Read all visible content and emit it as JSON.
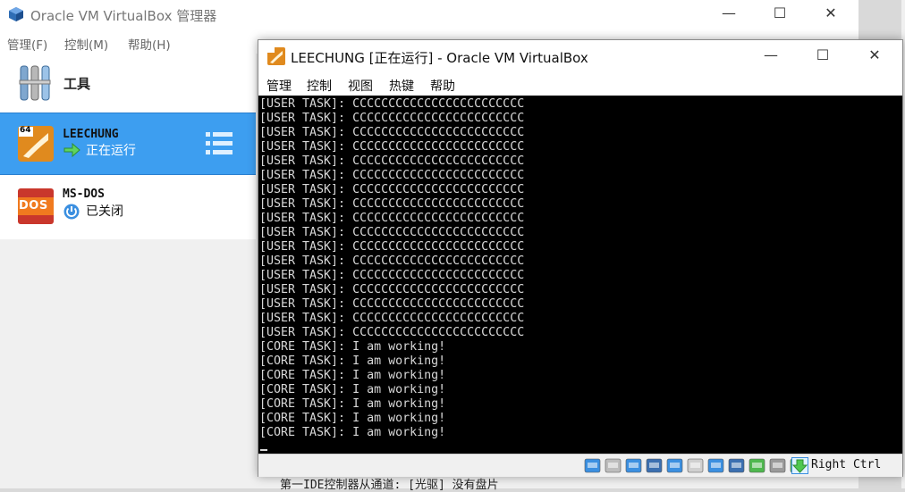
{
  "manager": {
    "title": "Oracle VM VirtualBox 管理器",
    "menu": [
      "管理(F)",
      "控制(M)",
      "帮助(H)"
    ],
    "tools_label": "工具",
    "vms": [
      {
        "name": "LEECHUNG",
        "state": "正在运行",
        "selected": true,
        "badge": "64"
      },
      {
        "name": "MS-DOS",
        "state": "已关闭",
        "selected": false,
        "badge": "DOS"
      }
    ],
    "bottom_text": "第一IDE控制器从通道: [光驱] 没有盘片"
  },
  "vm_window": {
    "title": "LEECHUNG [正在运行] - Oracle VM VirtualBox",
    "menu": [
      "管理",
      "控制",
      "视图",
      "热键",
      "帮助"
    ],
    "screen_lines": [
      "[USER TASK]: CCCCCCCCCCCCCCCCCCCCCCCC",
      "[USER TASK]: CCCCCCCCCCCCCCCCCCCCCCCC",
      "[USER TASK]: CCCCCCCCCCCCCCCCCCCCCCCC",
      "[USER TASK]: CCCCCCCCCCCCCCCCCCCCCCCC",
      "[USER TASK]: CCCCCCCCCCCCCCCCCCCCCCCC",
      "[USER TASK]: CCCCCCCCCCCCCCCCCCCCCCCC",
      "[USER TASK]: CCCCCCCCCCCCCCCCCCCCCCCC",
      "[USER TASK]: CCCCCCCCCCCCCCCCCCCCCCCC",
      "[USER TASK]: CCCCCCCCCCCCCCCCCCCCCCCC",
      "[USER TASK]: CCCCCCCCCCCCCCCCCCCCCCCC",
      "[USER TASK]: CCCCCCCCCCCCCCCCCCCCCCCC",
      "[USER TASK]: CCCCCCCCCCCCCCCCCCCCCCCC",
      "[USER TASK]: CCCCCCCCCCCCCCCCCCCCCCCC",
      "[USER TASK]: CCCCCCCCCCCCCCCCCCCCCCCC",
      "[USER TASK]: CCCCCCCCCCCCCCCCCCCCCCCC",
      "[USER TASK]: CCCCCCCCCCCCCCCCCCCCCCCC",
      "[USER TASK]: CCCCCCCCCCCCCCCCCCCCCCCC",
      "[CORE TASK]: I am working!",
      "[CORE TASK]: I am working!",
      "[CORE TASK]: I am working!",
      "[CORE TASK]: I am working!",
      "[CORE TASK]: I am working!",
      "[CORE TASK]: I am working!",
      "[CORE TASK]: I am working!"
    ],
    "host_key": "Right Ctrl",
    "status_icons": [
      "hard-disk-icon",
      "optical-disk-icon",
      "audio-icon",
      "network-icon",
      "usb-icon",
      "shared-folders-icon",
      "display-icon",
      "video-capture-icon",
      "cpu-activity-icon",
      "mouse-integration-icon",
      "keyboard-capture-icon"
    ]
  },
  "colors": {
    "selection": "#3d9ef0",
    "screen_bg": "#000000",
    "screen_fg": "#d8d8d8"
  }
}
